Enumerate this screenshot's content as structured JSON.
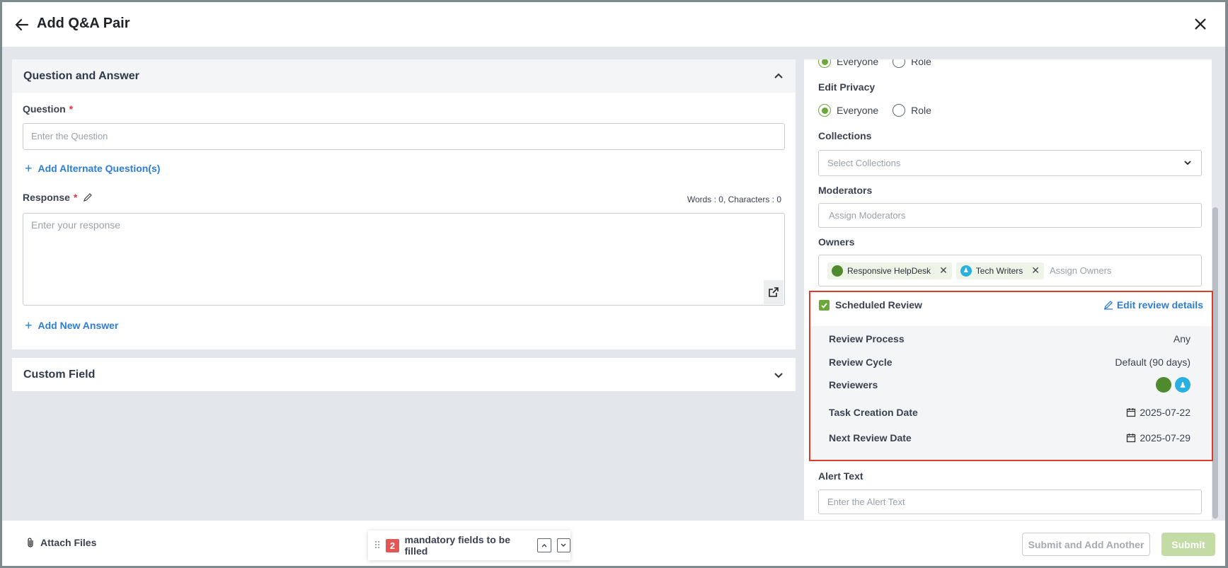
{
  "header": {
    "title": "Add Q&A Pair"
  },
  "qa": {
    "section_title": "Question and Answer",
    "question_label": "Question",
    "question_placeholder": "Enter the Question",
    "add_alternate": "Add Alternate Question(s)",
    "response_label": "Response",
    "word_count": "Words : 0, Characters : 0",
    "response_placeholder": "Enter your response",
    "add_answer": "Add New Answer",
    "required_mark": "*"
  },
  "custom_field": {
    "title": "Custom Field"
  },
  "right": {
    "view_privacy_options": [
      "Everyone",
      "Role"
    ],
    "edit_privacy_label": "Edit Privacy",
    "edit_privacy_options": [
      "Everyone",
      "Role"
    ],
    "collections_label": "Collections",
    "collections_placeholder": "Select Collections",
    "moderators_label": "Moderators",
    "moderators_placeholder": "Assign Moderators",
    "owners_label": "Owners",
    "owners": [
      "Responsive HelpDesk",
      "Tech Writers"
    ],
    "owners_placeholder": "Assign Owners",
    "alert_label": "Alert Text",
    "alert_placeholder": "Enter the Alert Text"
  },
  "scheduled_review": {
    "title": "Scheduled Review",
    "edit_link": "Edit review details",
    "checked": true,
    "rows": [
      {
        "key": "Review Process",
        "value": "Any"
      },
      {
        "key": "Review Cycle",
        "value": "Default (90 days)"
      },
      {
        "key": "Reviewers",
        "value": ""
      },
      {
        "key": "Task Creation Date",
        "value": "2025-07-22"
      },
      {
        "key": "Next Review Date",
        "value": "2025-07-29"
      }
    ]
  },
  "footer": {
    "attach": "Attach Files",
    "mandatory_count": "2",
    "mandatory_text": "mandatory fields to be filled",
    "submit_another": "Submit and Add Another",
    "submit": "Submit"
  },
  "colors": {
    "accent_green": "#6aa83a",
    "link_blue": "#2e7dd6",
    "highlight_red": "#e23a2a"
  }
}
